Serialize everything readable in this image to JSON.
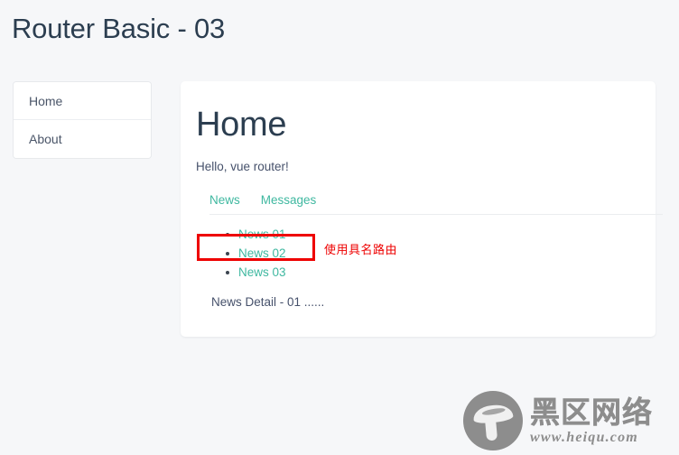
{
  "page": {
    "title": "Router Basic - 03",
    "background_color": "#f6f7f9",
    "heading_color": "#2c3e50",
    "accent_color": "#3fb8a0",
    "annotation_color": "#ee0000"
  },
  "sidebar": {
    "items": [
      {
        "label": "Home"
      },
      {
        "label": "About"
      }
    ]
  },
  "main": {
    "heading": "Home",
    "subtext": "Hello, vue router!",
    "tabs": [
      {
        "label": "News"
      },
      {
        "label": "Messages"
      }
    ],
    "news_items": [
      {
        "label": "News 01"
      },
      {
        "label": "News 02"
      },
      {
        "label": "News 03"
      }
    ],
    "detail_text": "News Detail - 01 ......"
  },
  "annotation": {
    "text": "使用具名路由",
    "target": "News 01"
  },
  "watermark": {
    "logo_name": "mushroom-logo",
    "cn_text": "黑区网络",
    "url_text": "www.heiqu.com"
  }
}
